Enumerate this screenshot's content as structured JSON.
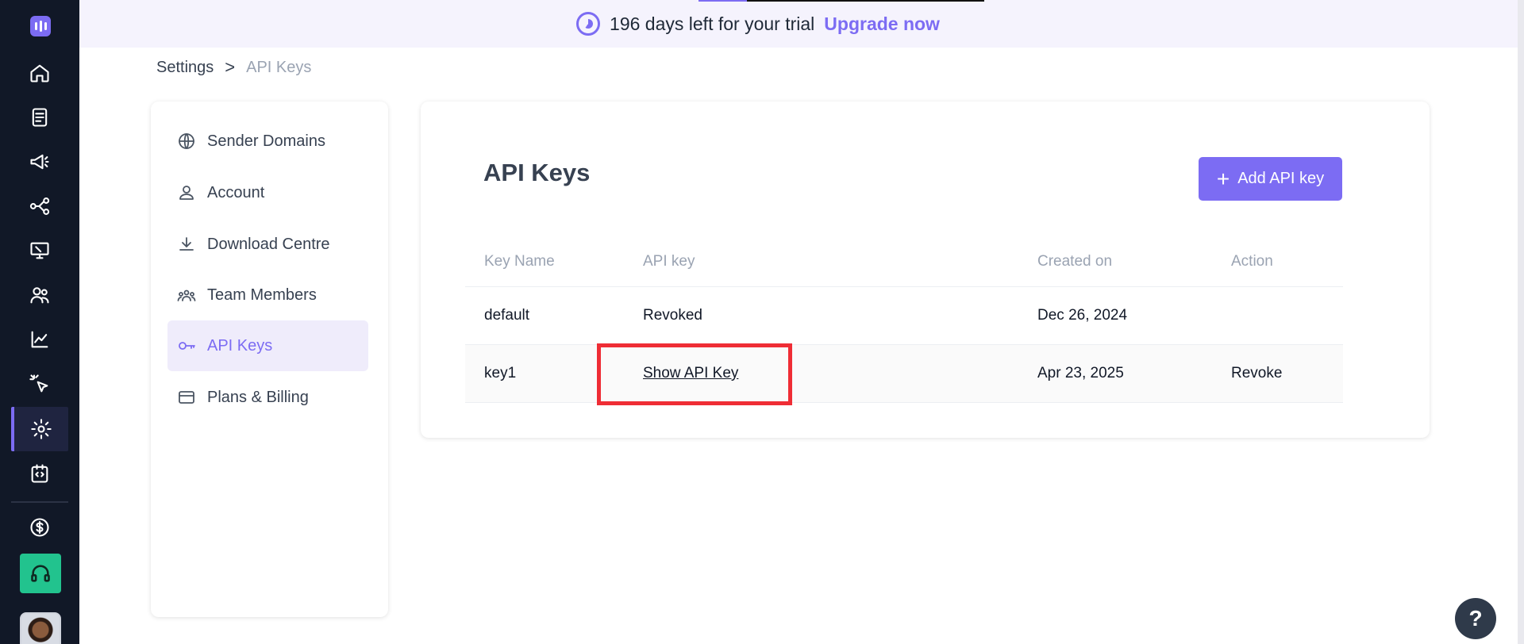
{
  "banner": {
    "trial_text": "196 days left for your trial",
    "upgrade_label": "Upgrade now",
    "trial_progress": 0.17
  },
  "breadcrumb": {
    "root": "Settings",
    "separator": ">",
    "current": "API Keys"
  },
  "side_menu": {
    "items": [
      {
        "label": "Sender Domains",
        "icon": "globe-icon"
      },
      {
        "label": "Account",
        "icon": "user-icon"
      },
      {
        "label": "Download Centre",
        "icon": "download-icon"
      },
      {
        "label": "Team Members",
        "icon": "team-icon"
      },
      {
        "label": "API Keys",
        "icon": "key-icon",
        "active": true
      },
      {
        "label": "Plans & Billing",
        "icon": "credit-card-icon"
      }
    ]
  },
  "main": {
    "title": "API Keys",
    "add_button_label": "Add API key",
    "table": {
      "headers": [
        "Key Name",
        "API key",
        "Created on",
        "Action"
      ],
      "rows": [
        {
          "name": "default",
          "key": "Revoked",
          "created": "Dec 26, 2024",
          "action": ""
        },
        {
          "name": "key1",
          "key": "Show API Key",
          "created": "Apr 23, 2025",
          "action": "Revoke"
        }
      ]
    }
  },
  "help_label": "?",
  "nav_rail": {
    "icons": [
      "home-icon",
      "document-icon",
      "megaphone-icon",
      "workflow-icon",
      "screen-icon",
      "contacts-icon",
      "analytics-icon",
      "click-icon",
      "settings-icon",
      "code-icon",
      "dollar-icon",
      "headset-icon"
    ]
  },
  "colors": {
    "accent": "#7c6cf3",
    "rail": "#111827",
    "support": "#22c38e",
    "highlight": "#ef2d35"
  }
}
